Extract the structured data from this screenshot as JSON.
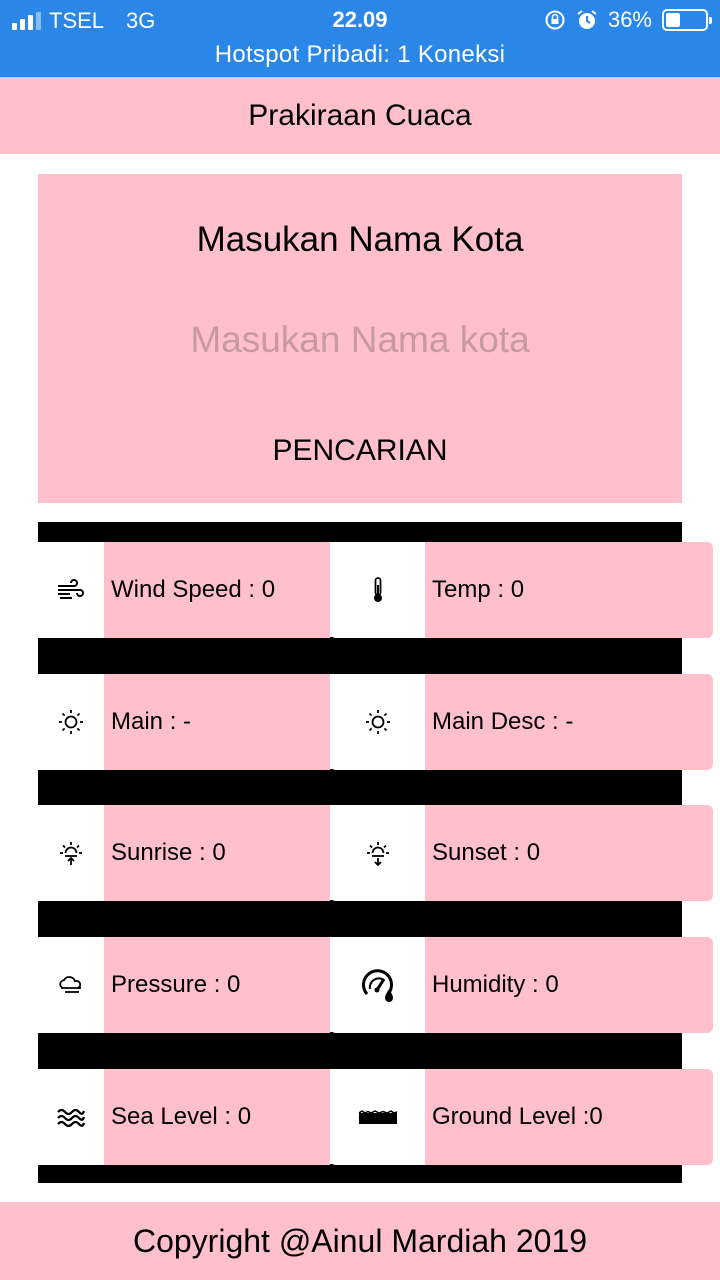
{
  "status_bar": {
    "carrier": "TSEL",
    "network": "3G",
    "time": "22.09",
    "battery": "36%",
    "battery_level": 0.36,
    "hotspot": "Hotspot Pribadi: 1 Koneksi"
  },
  "header": {
    "title": "Prakiraan Cuaca"
  },
  "search": {
    "title": "Masukan Nama Kota",
    "placeholder": "Masukan Nama kota",
    "button_label": "PENCARIAN"
  },
  "weather": [
    {
      "left": {
        "icon": "wind-icon",
        "label": "Wind Speed : 0"
      },
      "right": {
        "icon": "thermometer-icon",
        "label": "Temp : 0"
      }
    },
    {
      "left": {
        "icon": "sun-icon",
        "label": "Main : -"
      },
      "right": {
        "icon": "sun-icon",
        "label": "Main Desc : -"
      }
    },
    {
      "left": {
        "icon": "sunrise-icon",
        "label": "Sunrise : 0"
      },
      "right": {
        "icon": "sunset-icon",
        "label": "Sunset : 0"
      }
    },
    {
      "left": {
        "icon": "cloud-wind-icon",
        "label": "Pressure : 0"
      },
      "right": {
        "icon": "humidity-gauge-icon",
        "label": "Humidity : 0"
      }
    },
    {
      "left": {
        "icon": "waves-icon",
        "label": "Sea Level : 0"
      },
      "right": {
        "icon": "ground-icon",
        "label": "Ground Level :0"
      }
    }
  ],
  "footer": {
    "text": "Copyright @Ainul Mardiah 2019"
  },
  "colors": {
    "status_bar": "#2a87e8",
    "pink": "#ffc0cb",
    "bar": "#000000"
  }
}
